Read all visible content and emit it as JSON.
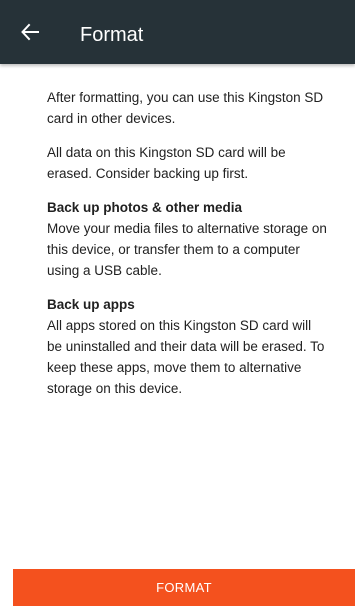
{
  "header": {
    "title": "Format",
    "back_icon": "arrow-back-icon"
  },
  "body": {
    "intro": "After formatting, you can use this Kingston SD card in other devices.",
    "warning": "All data on this Kingston SD card will be erased. Consider backing up first.",
    "media_heading": "Back up photos & other media",
    "media_text": "Move your media files to alternative storage on this device, or transfer them to a computer using a USB cable.",
    "apps_heading": "Back up apps",
    "apps_text": "All apps stored on this Kingston SD card will be uninstalled and their data will be erased. To keep these apps, move them to alternative storage on this device."
  },
  "footer": {
    "format_label": "FORMAT"
  },
  "colors": {
    "app_bar": "#263238",
    "accent": "#f4511e"
  }
}
